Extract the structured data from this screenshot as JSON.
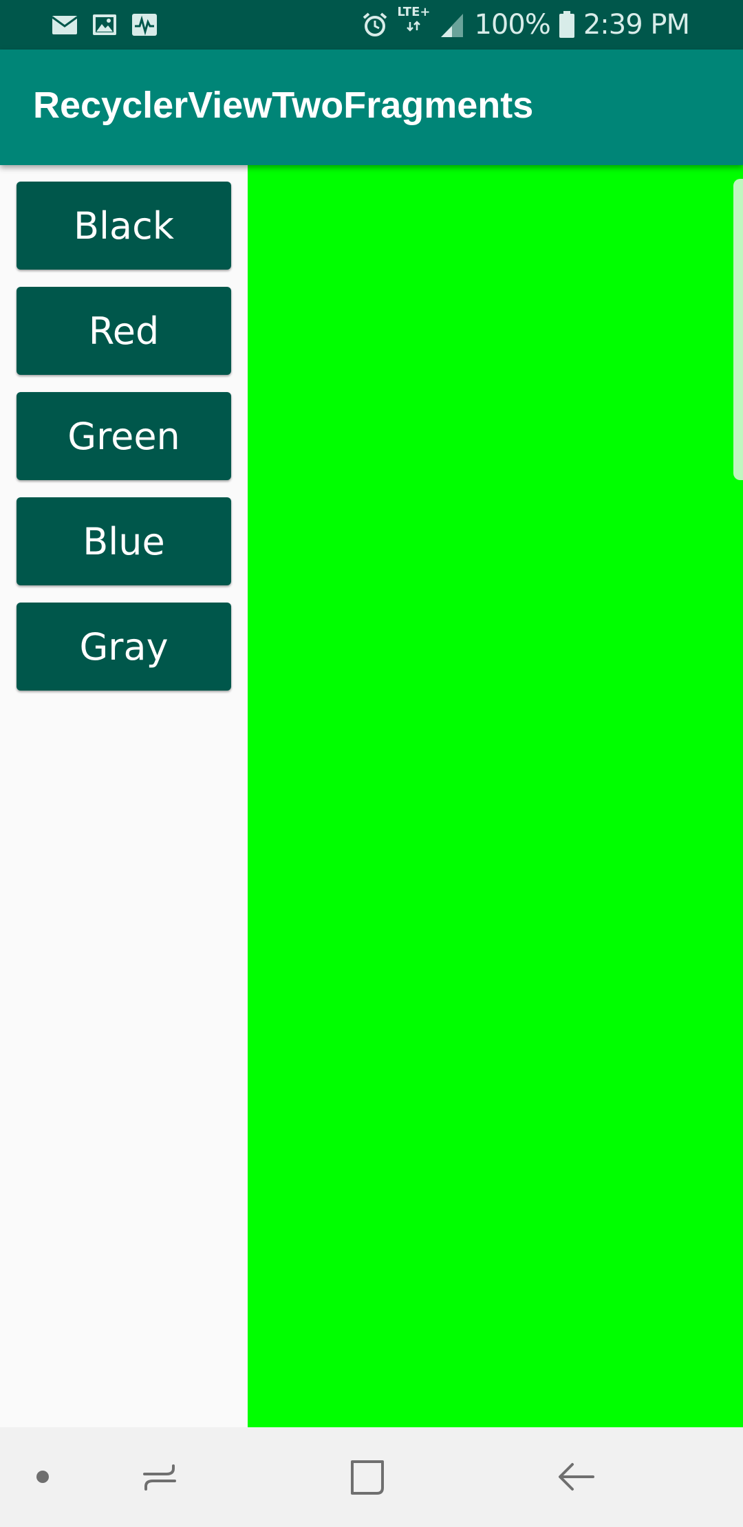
{
  "status_bar": {
    "left_icons": [
      "email-icon",
      "image-icon",
      "activity-icon"
    ],
    "network": "LTE+",
    "battery_percent": "100%",
    "time": "2:39 PM",
    "right_icons": [
      "alarm-icon",
      "signal-icon",
      "battery-icon"
    ]
  },
  "app_bar": {
    "title": "RecyclerViewTwoFragments",
    "background": "#008577"
  },
  "buttons": [
    {
      "label": "Black"
    },
    {
      "label": "Red"
    },
    {
      "label": "Green"
    },
    {
      "label": "Blue"
    },
    {
      "label": "Gray"
    }
  ],
  "detail_pane": {
    "color": "#00ff00"
  },
  "nav_bar": {
    "items": [
      "dot-icon",
      "recents-icon",
      "home-icon",
      "back-icon"
    ]
  },
  "colors": {
    "status_bar": "#00574b",
    "button": "#00574b",
    "accent": "#008577"
  }
}
